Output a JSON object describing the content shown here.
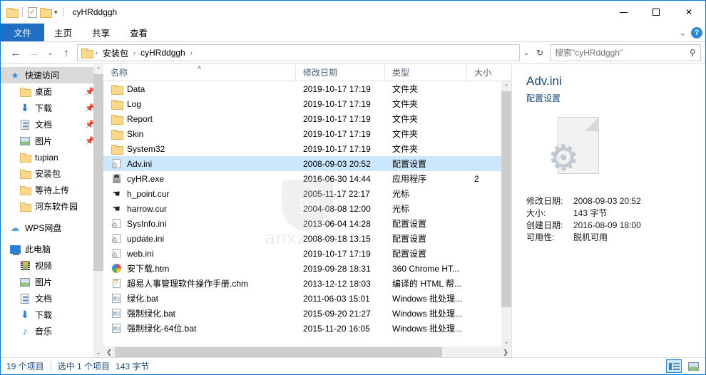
{
  "window": {
    "title": "cyHRddggh",
    "quick_access_icons": [
      "folder-icon",
      "properties-icon",
      "new-folder-icon",
      "customize-dropdown-icon"
    ],
    "controls": {
      "minimize": "─",
      "maximize": "□",
      "close": "✕"
    }
  },
  "ribbon": {
    "tabs": [
      {
        "label": "文件",
        "active": true
      },
      {
        "label": "主页",
        "active": false
      },
      {
        "label": "共享",
        "active": false
      },
      {
        "label": "查看",
        "active": false
      }
    ],
    "collapse_icon": "chevron-down-icon",
    "help_icon": "help-icon",
    "help_glyph": "?",
    "accent_color": "#1f6fc4"
  },
  "address": {
    "back_icon": "←",
    "forward_icon": "→",
    "recent_icon": "⌄",
    "up_icon": "↑",
    "breadcrumbs": [
      "安装包",
      "cyHRddggh"
    ],
    "separator": "›",
    "dropdown_icon": "⌄",
    "refresh_icon": "↻"
  },
  "search": {
    "placeholder": "搜索\"cyHRddggh\"",
    "value": "",
    "icon": "search-icon"
  },
  "sidebar": {
    "groups": [
      {
        "header": {
          "label": "快速访问",
          "icon": "star-icon",
          "selected": true
        },
        "items": [
          {
            "label": "桌面",
            "icon": "folder-icon",
            "pinned": true
          },
          {
            "label": "下载",
            "icon": "download-icon",
            "pinned": true
          },
          {
            "label": "文档",
            "icon": "document-icon",
            "pinned": true
          },
          {
            "label": "图片",
            "icon": "picture-icon",
            "pinned": true
          },
          {
            "label": "tupian",
            "icon": "folder-icon",
            "pinned": false
          },
          {
            "label": "安装包",
            "icon": "folder-icon",
            "pinned": false
          },
          {
            "label": "等待上传",
            "icon": "folder-icon",
            "pinned": false
          },
          {
            "label": "河东软件园",
            "icon": "folder-icon",
            "pinned": false
          }
        ]
      },
      {
        "header": {
          "label": "WPS网盘",
          "icon": "cloud-icon",
          "selected": false
        },
        "items": []
      },
      {
        "header": {
          "label": "此电脑",
          "icon": "computer-icon",
          "selected": false
        },
        "items": [
          {
            "label": "视频",
            "icon": "video-icon",
            "pinned": false
          },
          {
            "label": "图片",
            "icon": "picture-icon",
            "pinned": false
          },
          {
            "label": "文档",
            "icon": "document-icon",
            "pinned": false
          },
          {
            "label": "下载",
            "icon": "download-icon",
            "pinned": false
          },
          {
            "label": "音乐",
            "icon": "music-icon",
            "pinned": false
          }
        ]
      }
    ],
    "pin_glyph": "📌"
  },
  "filelist": {
    "columns": [
      {
        "key": "name",
        "label": "名称",
        "sorted": "asc"
      },
      {
        "key": "date",
        "label": "修改日期",
        "sorted": ""
      },
      {
        "key": "type",
        "label": "类型",
        "sorted": ""
      },
      {
        "key": "size",
        "label": "大小",
        "sorted": ""
      }
    ],
    "sort_caret": "˄",
    "rows": [
      {
        "name": "Data",
        "date": "2019-10-17 17:19",
        "type": "文件夹",
        "size": "",
        "icon": "folder-icon",
        "selected": false
      },
      {
        "name": "Log",
        "date": "2019-10-17 17:19",
        "type": "文件夹",
        "size": "",
        "icon": "folder-icon",
        "selected": false
      },
      {
        "name": "Report",
        "date": "2019-10-17 17:19",
        "type": "文件夹",
        "size": "",
        "icon": "folder-icon",
        "selected": false
      },
      {
        "name": "Skin",
        "date": "2019-10-17 17:19",
        "type": "文件夹",
        "size": "",
        "icon": "folder-icon",
        "selected": false
      },
      {
        "name": "System32",
        "date": "2019-10-17 17:19",
        "type": "文件夹",
        "size": "",
        "icon": "folder-icon",
        "selected": false
      },
      {
        "name": "Adv.ini",
        "date": "2008-09-03 20:52",
        "type": "配置设置",
        "size": "",
        "icon": "ini-icon",
        "selected": true
      },
      {
        "name": "cyHR.exe",
        "date": "2016-06-30 14:44",
        "type": "应用程序",
        "size": "2",
        "icon": "exe-icon",
        "selected": false
      },
      {
        "name": "h_point.cur",
        "date": "2005-11-17 22:17",
        "type": "光标",
        "size": "",
        "icon": "cursor-icon",
        "selected": false
      },
      {
        "name": "harrow.cur",
        "date": "2004-08-08 12:00",
        "type": "光标",
        "size": "",
        "icon": "cursor-icon",
        "selected": false
      },
      {
        "name": "SysInfo.ini",
        "date": "2013-06-04 14:28",
        "type": "配置设置",
        "size": "",
        "icon": "ini-icon",
        "selected": false
      },
      {
        "name": "update.ini",
        "date": "2008-09-18 13:15",
        "type": "配置设置",
        "size": "",
        "icon": "ini-icon",
        "selected": false
      },
      {
        "name": "web.ini",
        "date": "2019-10-17 17:19",
        "type": "配置设置",
        "size": "",
        "icon": "ini-icon",
        "selected": false
      },
      {
        "name": "安下载.htm",
        "date": "2019-09-28 18:31",
        "type": "360 Chrome HT...",
        "size": "",
        "icon": "html-icon",
        "selected": false
      },
      {
        "name": "超易人事管理软件操作手册.chm",
        "date": "2013-12-12 18:03",
        "type": "编译的 HTML 帮...",
        "size": "",
        "icon": "chm-icon",
        "selected": false
      },
      {
        "name": "绿化.bat",
        "date": "2011-06-03 15:01",
        "type": "Windows 批处理...",
        "size": "",
        "icon": "bat-icon",
        "selected": false
      },
      {
        "name": "强制绿化.bat",
        "date": "2015-09-20 21:27",
        "type": "Windows 批处理...",
        "size": "",
        "icon": "bat-icon",
        "selected": false
      },
      {
        "name": "强制绿化-64位.bat",
        "date": "2015-11-20 16:05",
        "type": "Windows 批处理...",
        "size": "",
        "icon": "bat-icon",
        "selected": false
      }
    ],
    "watermark": "anxz.com",
    "watermark_glyph": "安"
  },
  "details": {
    "filename": "Adv.ini",
    "filetype": "配置设置",
    "icon": "ini-file-large-icon",
    "meta": [
      {
        "key": "修改日期:",
        "value": "2008-09-03 20:52"
      },
      {
        "key": "大小:",
        "value": "143 字节"
      },
      {
        "key": "创建日期:",
        "value": "2016-08-09 18:00"
      },
      {
        "key": "可用性:",
        "value": "脱机可用"
      }
    ]
  },
  "statusbar": {
    "item_count": "19 个项目",
    "selection": "选中 1 个项目",
    "selection_size": "143 字节",
    "views": [
      {
        "name": "details-view",
        "active": true
      },
      {
        "name": "large-icons-view",
        "active": false
      }
    ]
  }
}
